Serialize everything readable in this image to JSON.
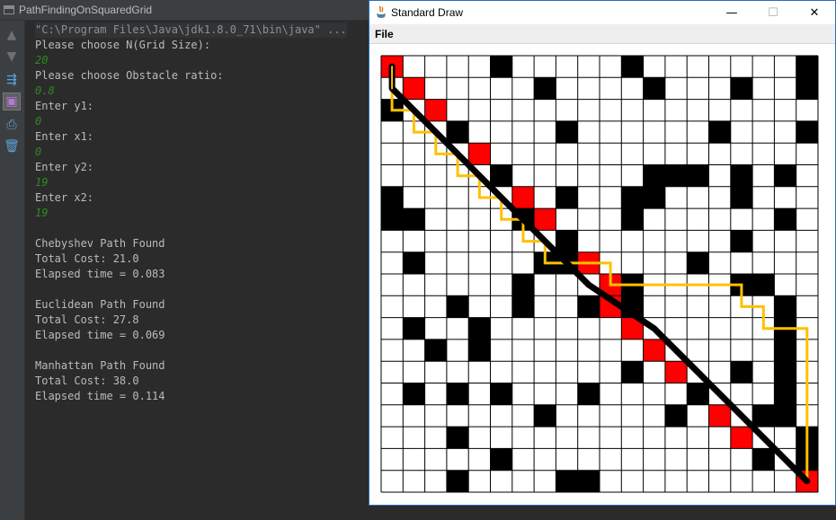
{
  "ide": {
    "run_tab_label": "PathFindingOnSquaredGrid",
    "toolbar_icons": [
      "arrow-up-icon",
      "arrow-down-icon",
      "soft-wrap-icon",
      "scroll-to-end-icon",
      "print-icon",
      "trash-icon"
    ]
  },
  "console": {
    "lines": [
      {
        "text": "\"C:\\Program Files\\Java\\jdk1.8.0_71\\bin\\java\" ...",
        "kind": "cmd"
      },
      {
        "text": "Please choose N(Grid Size):",
        "kind": "out"
      },
      {
        "text": "20",
        "kind": "input"
      },
      {
        "text": "Please choose Obstacle ratio:",
        "kind": "out"
      },
      {
        "text": "0.8",
        "kind": "input"
      },
      {
        "text": "Enter y1:",
        "kind": "out"
      },
      {
        "text": "0",
        "kind": "input"
      },
      {
        "text": "Enter x1:",
        "kind": "out"
      },
      {
        "text": "0",
        "kind": "input"
      },
      {
        "text": "Enter y2:",
        "kind": "out"
      },
      {
        "text": "19",
        "kind": "input"
      },
      {
        "text": "Enter x2:",
        "kind": "out"
      },
      {
        "text": "19",
        "kind": "input"
      },
      {
        "text": "",
        "kind": "out"
      },
      {
        "text": "Chebyshev Path Found",
        "kind": "out"
      },
      {
        "text": "Total Cost: 21.0",
        "kind": "out"
      },
      {
        "text": "Elapsed time = 0.083",
        "kind": "out"
      },
      {
        "text": "",
        "kind": "out"
      },
      {
        "text": "Euclidean Path Found",
        "kind": "out"
      },
      {
        "text": "Total Cost: 27.8",
        "kind": "out"
      },
      {
        "text": "Elapsed time = 0.069",
        "kind": "out"
      },
      {
        "text": "",
        "kind": "out"
      },
      {
        "text": "Manhattan Path Found",
        "kind": "out"
      },
      {
        "text": "Total Cost: 38.0",
        "kind": "out"
      },
      {
        "text": "Elapsed time = 0.114",
        "kind": "out"
      }
    ]
  },
  "window": {
    "title": "Standard Draw",
    "minimize": "—",
    "maximize": "☐",
    "close": "✕",
    "menu_file": "File"
  },
  "grid": {
    "n": 20,
    "colors": {
      "blocked": "#000000",
      "red": "#ff0000",
      "line": "#000000",
      "euclid": "#000000",
      "manhattan": "#ffc000"
    },
    "blocked": [
      [
        0,
        5
      ],
      [
        0,
        11
      ],
      [
        0,
        19
      ],
      [
        1,
        7
      ],
      [
        1,
        12
      ],
      [
        1,
        16
      ],
      [
        1,
        19
      ],
      [
        2,
        0
      ],
      [
        3,
        3
      ],
      [
        3,
        8
      ],
      [
        3,
        15
      ],
      [
        3,
        19
      ],
      [
        5,
        5
      ],
      [
        5,
        12
      ],
      [
        5,
        13
      ],
      [
        5,
        14
      ],
      [
        5,
        16
      ],
      [
        5,
        18
      ],
      [
        6,
        0
      ],
      [
        6,
        8
      ],
      [
        6,
        11
      ],
      [
        6,
        12
      ],
      [
        6,
        16
      ],
      [
        7,
        0
      ],
      [
        7,
        1
      ],
      [
        7,
        6
      ],
      [
        7,
        11
      ],
      [
        7,
        18
      ],
      [
        8,
        8
      ],
      [
        8,
        16
      ],
      [
        9,
        1
      ],
      [
        9,
        7
      ],
      [
        9,
        8
      ],
      [
        9,
        14
      ],
      [
        10,
        6
      ],
      [
        10,
        11
      ],
      [
        10,
        16
      ],
      [
        10,
        17
      ],
      [
        11,
        3
      ],
      [
        11,
        6
      ],
      [
        11,
        9
      ],
      [
        11,
        11
      ],
      [
        11,
        18
      ],
      [
        12,
        1
      ],
      [
        12,
        4
      ],
      [
        12,
        18
      ],
      [
        13,
        2
      ],
      [
        13,
        4
      ],
      [
        13,
        18
      ],
      [
        14,
        11
      ],
      [
        14,
        16
      ],
      [
        14,
        18
      ],
      [
        15,
        1
      ],
      [
        15,
        3
      ],
      [
        15,
        5
      ],
      [
        15,
        9
      ],
      [
        15,
        14
      ],
      [
        15,
        18
      ],
      [
        16,
        7
      ],
      [
        16,
        13
      ],
      [
        16,
        17
      ],
      [
        16,
        18
      ],
      [
        17,
        3
      ],
      [
        17,
        19
      ],
      [
        18,
        5
      ],
      [
        18,
        17
      ],
      [
        18,
        19
      ],
      [
        19,
        3
      ],
      [
        19,
        8
      ],
      [
        19,
        9
      ]
    ],
    "red": [
      [
        0,
        0
      ],
      [
        1,
        1
      ],
      [
        2,
        2
      ],
      [
        3,
        3
      ],
      [
        4,
        4
      ],
      [
        5,
        5
      ],
      [
        6,
        6
      ],
      [
        7,
        7
      ],
      [
        8,
        8
      ],
      [
        9,
        9
      ],
      [
        10,
        10
      ],
      [
        11,
        10
      ],
      [
        12,
        11
      ],
      [
        13,
        12
      ],
      [
        14,
        13
      ],
      [
        15,
        14
      ],
      [
        16,
        15
      ],
      [
        17,
        16
      ],
      [
        18,
        17
      ],
      [
        19,
        19
      ]
    ],
    "euclidean_path": [
      [
        0,
        0
      ],
      [
        1,
        0
      ],
      [
        9,
        8
      ],
      [
        10,
        9
      ],
      [
        12,
        12
      ],
      [
        19,
        19
      ]
    ],
    "manhattan_path": [
      [
        0,
        0
      ],
      [
        1,
        0
      ],
      [
        2,
        0
      ],
      [
        2,
        1
      ],
      [
        3,
        1
      ],
      [
        3,
        2
      ],
      [
        4,
        2
      ],
      [
        4,
        3
      ],
      [
        5,
        3
      ],
      [
        5,
        4
      ],
      [
        6,
        4
      ],
      [
        6,
        5
      ],
      [
        7,
        5
      ],
      [
        7,
        6
      ],
      [
        8,
        6
      ],
      [
        8,
        7
      ],
      [
        9,
        7
      ],
      [
        9,
        10
      ],
      [
        10,
        10
      ],
      [
        10,
        16
      ],
      [
        11,
        16
      ],
      [
        11,
        17
      ],
      [
        12,
        17
      ],
      [
        12,
        19
      ],
      [
        19,
        19
      ]
    ],
    "chebyshev_path": [
      [
        0,
        0
      ],
      [
        1,
        0
      ]
    ]
  }
}
